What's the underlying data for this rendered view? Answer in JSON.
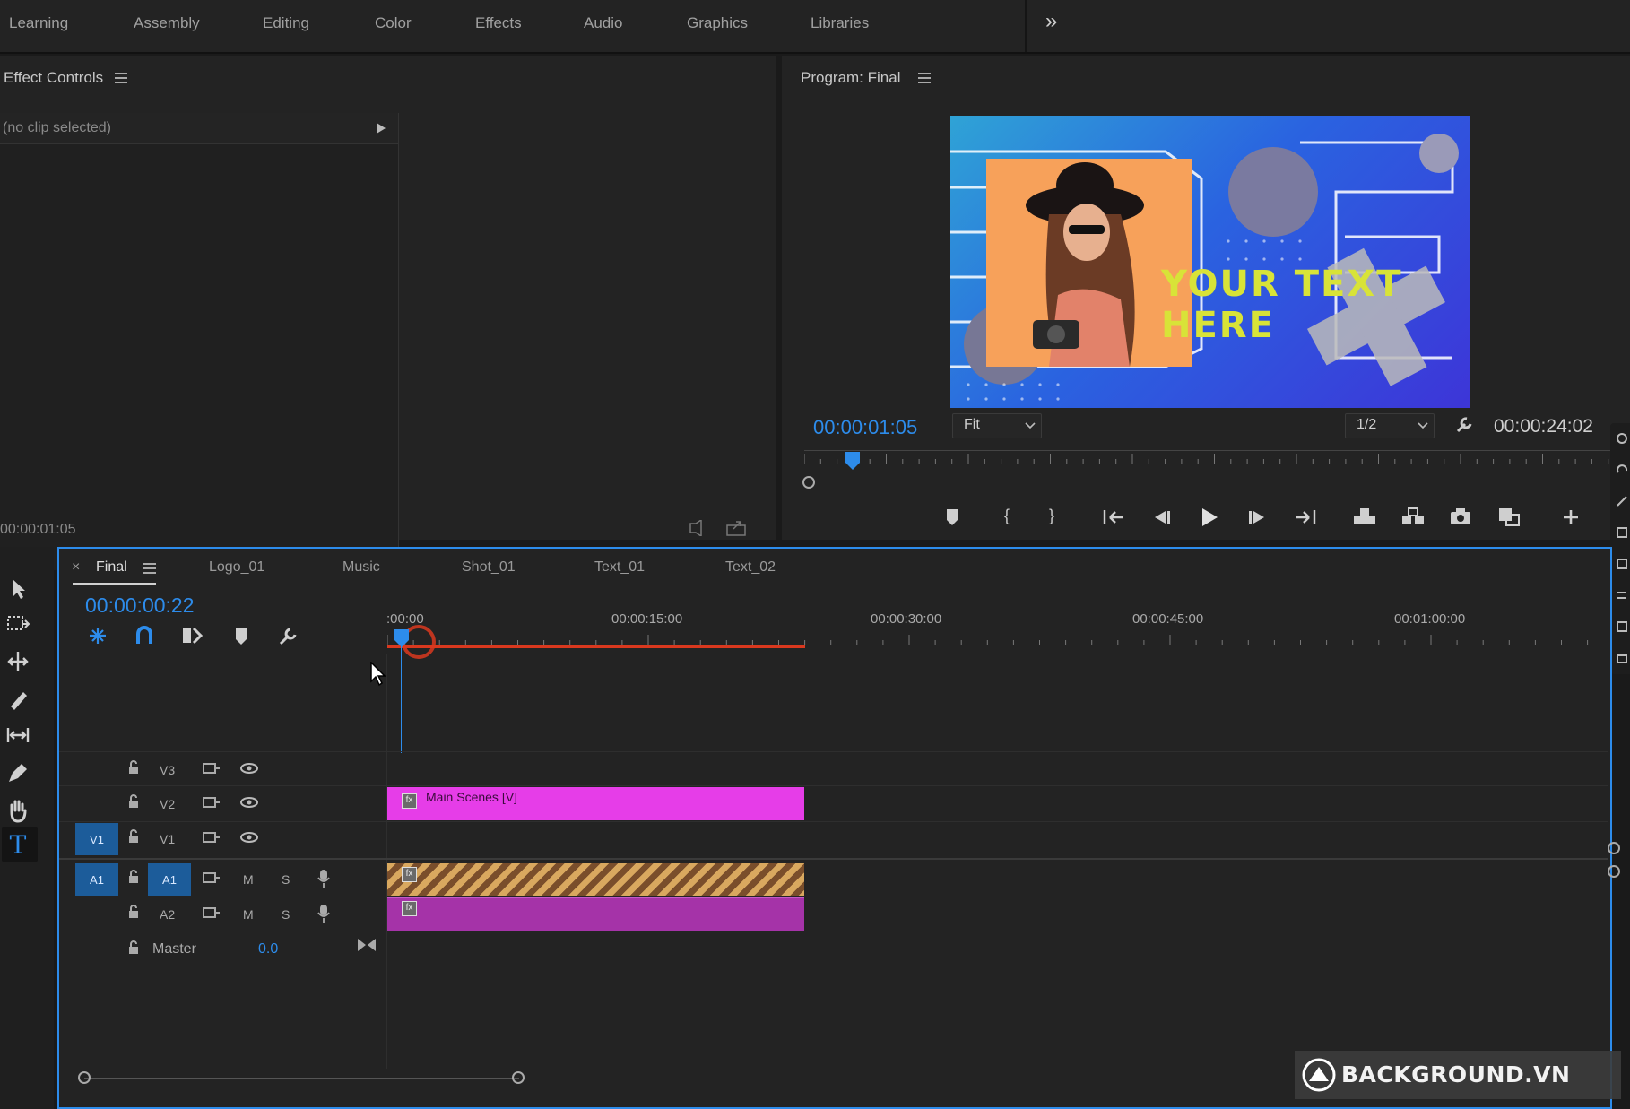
{
  "workspaces": [
    "Learning",
    "Assembly",
    "Editing",
    "Color",
    "Effects",
    "Audio",
    "Graphics",
    "Libraries"
  ],
  "more_glyph": "»",
  "effect_controls": {
    "title": "Effect Controls",
    "clip_selector": "(no clip selected)",
    "timecode": "00:00:01:05"
  },
  "program_monitor": {
    "title": "Program: Final",
    "current_time": "00:00:01:05",
    "zoom": "Fit",
    "resolution": "1/2",
    "duration": "00:00:24:02",
    "frame_text_line1": "YOUR TEXT",
    "frame_text_line2": "HERE",
    "playhead_position": 0.05
  },
  "timeline": {
    "tabs": [
      "Final",
      "Logo_01",
      "Music",
      "Shot_01",
      "Text_01",
      "Text_02"
    ],
    "active_tab": "Final",
    "close_glyph": "×",
    "timecode": "00:00:00:22",
    "ruler_labels": [
      ":00:00",
      "00:00:15:00",
      "00:00:30:00",
      "00:00:45:00",
      "00:01:00:00"
    ],
    "tracks": {
      "v3": "V3",
      "v2": "V2",
      "v1": "V1",
      "a1": "A1",
      "a2": "A2",
      "v1_source": "V1",
      "a1_source": "A1",
      "mute": "M",
      "solo": "S",
      "master_label": "Master",
      "master_value": "0.0"
    },
    "clips": {
      "video": "Main Scenes [V]",
      "fx_badge": "fx"
    }
  },
  "watermark": "BACKGROUND.VN",
  "colors": {
    "accent_blue": "#2d8ceb",
    "video_clip": "#e63de8",
    "audio_clip": "#a533a8",
    "audio_stripe": "#d9a85f",
    "work_area": "#d9381e",
    "panel_bg": "#232323"
  }
}
